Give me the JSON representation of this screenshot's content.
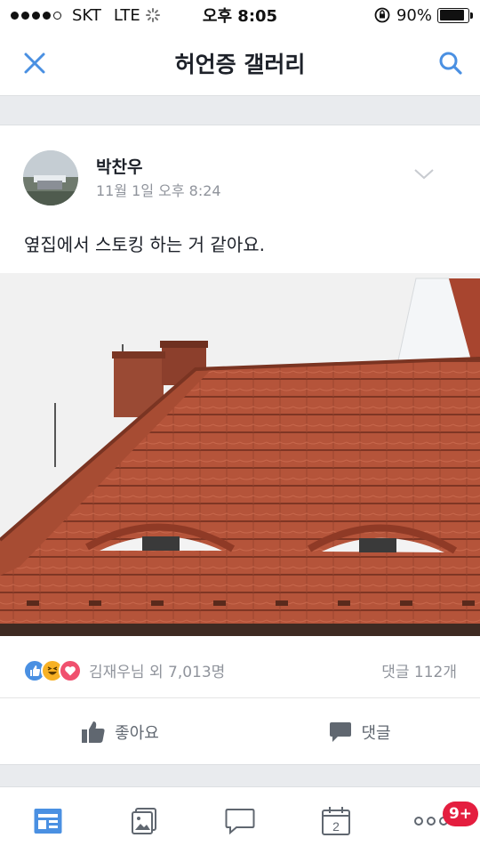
{
  "status_bar": {
    "carrier": "SKT",
    "network": "LTE",
    "time": "오후 8:05",
    "battery": "90%",
    "battery_level": 0.9
  },
  "header": {
    "title": "허언증 갤러리",
    "close_icon": "close-icon",
    "search_icon": "search-icon"
  },
  "post": {
    "author": "박찬우",
    "timestamp": "11월 1일 오후 8:24",
    "text": "옆집에서 스토킹 하는 거 같아요.",
    "reactions": {
      "icons": [
        "like-icon",
        "haha-icon",
        "love-icon"
      ],
      "summary": "김재우님 외 7,013명",
      "comments": "댓글 112개"
    },
    "actions": {
      "like_label": "좋아요",
      "comment_label": "댓글"
    }
  },
  "tab_bar": {
    "tabs": [
      "news-feed-icon",
      "photos-icon",
      "messages-icon",
      "events-icon",
      "more-icon"
    ],
    "event_day": "2",
    "more_badge": "9+"
  },
  "colors": {
    "accent": "#4a90e2",
    "badge": "#e41e3f",
    "muted_text": "#90949c"
  }
}
